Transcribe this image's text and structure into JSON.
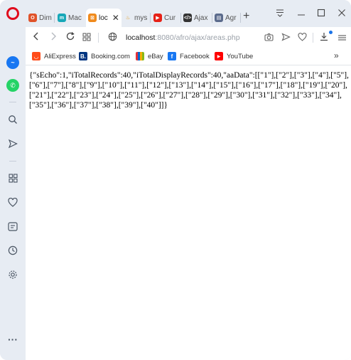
{
  "tabs": [
    {
      "label": "Dim",
      "favicon": "opera-red-icon",
      "color": "#e0532a"
    },
    {
      "label": "Mac",
      "favicon": "mac-teal-icon",
      "color": "#18a8b8"
    },
    {
      "label": "loc",
      "favicon": "localhost-orange-icon",
      "color": "#f08a1c",
      "active": true
    },
    {
      "label": "mys",
      "favicon": "mysql-icon",
      "color": "#e59b1e"
    },
    {
      "label": "Cur",
      "favicon": "youtube-icon",
      "color": "#e62117"
    },
    {
      "label": "Ajax",
      "favicon": "code-icon",
      "color": "#333333"
    },
    {
      "label": "Agr",
      "favicon": "doc-icon",
      "color": "#5b6b8c"
    }
  ],
  "new_tab_label": "+",
  "address": {
    "host": "localhost",
    "path": ":8080/afro/ajax/areas.php"
  },
  "bookmarks": [
    {
      "label": "AliExpress",
      "icon": "aliexpress-icon",
      "color": "#ff4c1a"
    },
    {
      "label": "Booking.com",
      "icon": "booking-icon",
      "color": "#003580"
    },
    {
      "label": "eBay",
      "icon": "ebay-icon",
      "color": "#e53238"
    },
    {
      "label": "Facebook",
      "icon": "facebook-icon",
      "color": "#1877f2"
    },
    {
      "label": "YouTube",
      "icon": "youtube-icon",
      "color": "#ff0000"
    }
  ],
  "bookmarks_more": "»",
  "page": {
    "json_text": "{\"sEcho\":1,\"iTotalRecords\":40,\"iTotalDisplayRecords\":40,\"aaData\":[[\"1\"],[\"2\"],[\"3\"],[\"4\"],[\"5\"],[\"6\"],[\"7\"],[\"8\"],[\"9\"],[\"10\"],[\"11\"],[\"12\"],[\"13\"],[\"14\"],[\"15\"],[\"16\"],[\"17\"],[\"18\"],[\"19\"],[\"20\"],[\"21\"],[\"22\"],[\"23\"],[\"24\"],[\"25\"],[\"26\"],[\"27\"],[\"28\"],[\"29\"],[\"30\"],[\"31\"],[\"32\"],[\"33\"],[\"34\"],[\"35\"],[\"36\"],[\"37\"],[\"38\"],[\"39\"],[\"40\"]]}"
  },
  "colors": {
    "opera_red": "#e00b1c",
    "sidebar_bg": "#e7ecf3",
    "accent": "#1a73e8"
  }
}
